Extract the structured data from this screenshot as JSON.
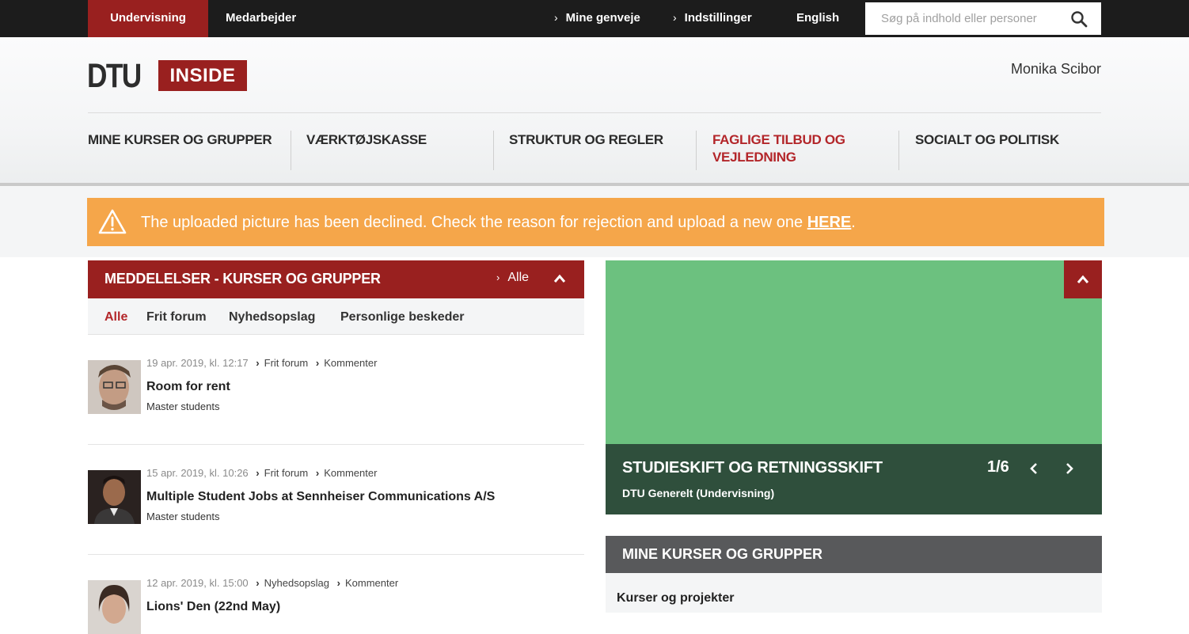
{
  "topbar": {
    "tabs": [
      {
        "label": "Undervisning",
        "active": true
      },
      {
        "label": "Medarbejder",
        "active": false
      }
    ],
    "links": [
      "Mine genveje",
      "Indstillinger"
    ],
    "language": "English",
    "search_placeholder": "Søg på indhold eller personer"
  },
  "header": {
    "logo_text": "DTU",
    "logo_badge": "INSIDE",
    "user_name": "Monika Scibor",
    "nav": [
      {
        "label": "MINE KURSER OG GRUPPER",
        "active": false
      },
      {
        "label": "VÆRKTØJSKASSE",
        "active": false
      },
      {
        "label": "STRUKTUR OG REGLER",
        "active": false
      },
      {
        "label_line1": "FAGLIGE TILBUD OG",
        "label_line2": "VEJLEDNING",
        "active": true
      },
      {
        "label": "SOCIALT OG POLITISK",
        "active": false
      }
    ]
  },
  "alert": {
    "message": "The uploaded picture has been declined. Check the reason for rejection and upload a new one ",
    "link_text": "HERE",
    "suffix": ".",
    "color": "#f5a64a"
  },
  "announcements": {
    "title": "MEDDELELSER - KURSER OG GRUPPER",
    "all_link": "Alle",
    "filters": [
      "Alle",
      "Frit forum",
      "Nyhedsopslag",
      "Personlige beskeder"
    ],
    "posts": [
      {
        "date": "19 apr. 2019, kl. 12:17",
        "category": "Frit forum",
        "action": "Kommenter",
        "title": "Room for rent",
        "group": "Master students"
      },
      {
        "date": "15 apr. 2019, kl. 10:26",
        "category": "Frit forum",
        "action": "Kommenter",
        "title": "Multiple Student Jobs at Sennheiser Communications A/S",
        "group": "Master students"
      },
      {
        "date": "12 apr. 2019, kl. 15:00",
        "category": "Nyhedsopslag",
        "action": "Kommenter",
        "title": "Lions' Den (22nd May)",
        "group": ""
      }
    ]
  },
  "carousel": {
    "title": "STUDIESKIFT OG RETNINGSSKIFT",
    "subtitle": "DTU Generelt (Undervisning)",
    "counter": "1/6",
    "image_color": "#6cc17f"
  },
  "courses": {
    "title": "MINE KURSER OG GRUPPER",
    "subheading": "Kurser og projekter"
  },
  "colors": {
    "brand_red": "#99201f",
    "active_text": "#b3262a",
    "topbar": "#1c1c1c"
  }
}
